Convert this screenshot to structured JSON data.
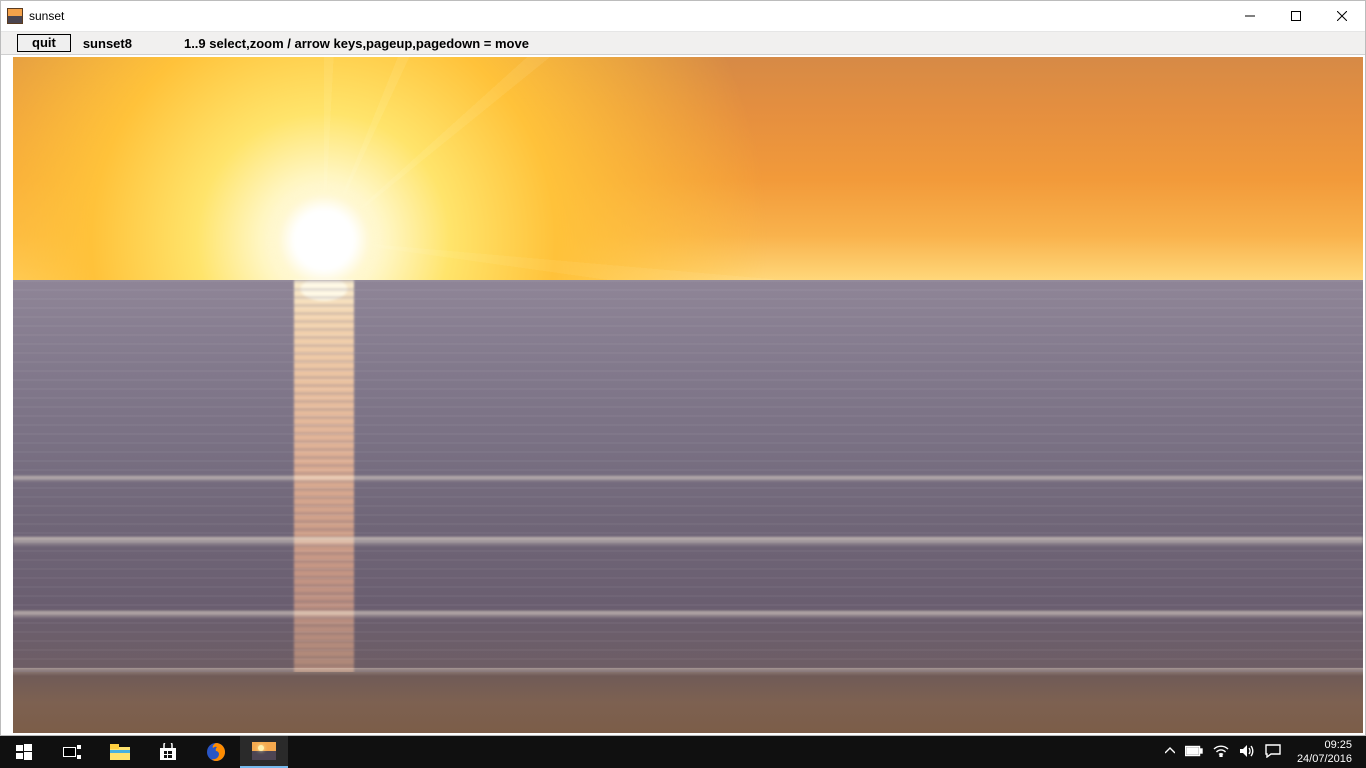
{
  "window": {
    "title": "sunset"
  },
  "toolbar": {
    "quit_label": "quit",
    "image_name": "sunset8",
    "help_text": "1..9 select,zoom / arrow keys,pageup,pagedown = move"
  },
  "taskbar": {
    "clock_time": "09:25",
    "clock_date": "24/07/2016"
  }
}
